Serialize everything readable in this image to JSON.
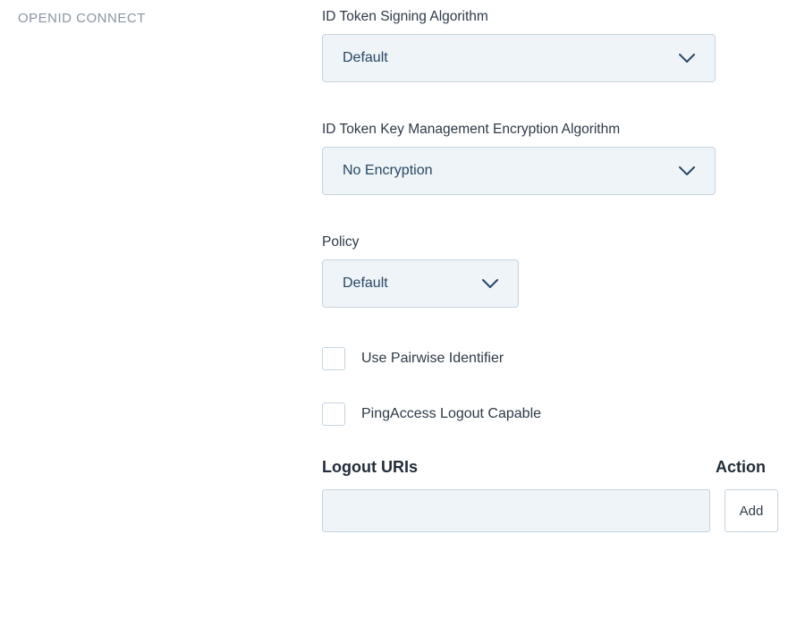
{
  "section_heading": "OPENID CONNECT",
  "fields": {
    "id_token_signing": {
      "label": "ID Token Signing Algorithm",
      "value": "Default"
    },
    "id_token_key_mgmt": {
      "label": "ID Token Key Management Encryption Algorithm",
      "value": "No Encryption"
    },
    "policy": {
      "label": "Policy",
      "value": "Default"
    },
    "use_pairwise": {
      "label": "Use Pairwise Identifier",
      "checked": false
    },
    "pingaccess_logout": {
      "label": "PingAccess Logout Capable",
      "checked": false
    },
    "logout_uris": {
      "heading": "Logout URIs",
      "action_heading": "Action",
      "input_value": "",
      "add_label": "Add"
    }
  }
}
